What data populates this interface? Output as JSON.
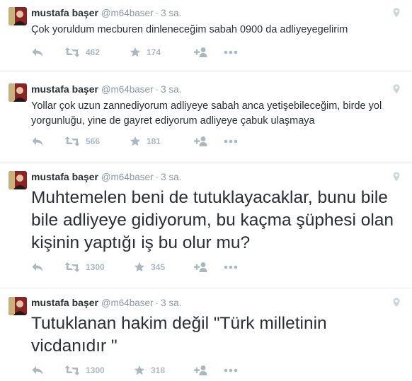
{
  "tweets": [
    {
      "name": "mustafa başer",
      "handle": "@m64baser",
      "time": "3 sa.",
      "text": "Çok yoruldum mecburen dinleneceğim sabah 0900 da adliyeyegelirim",
      "retweets": "462",
      "favorites": "174"
    },
    {
      "name": "mustafa başer",
      "handle": "@m64baser",
      "time": "3 sa.",
      "text": "Yollar çok uzun zannediyorum adliyeye sabah anca yetişebileceğim, birde yol yorgunluğu, yine de gayret ediyorum adliyeye çabuk ulaşmaya",
      "retweets": "566",
      "favorites": "181"
    },
    {
      "name": "mustafa başer",
      "handle": "@m64baser",
      "time": "3 sa.",
      "text": "Muhtemelen beni de tutuklayacaklar, bunu bile bile adliyeye gidiyorum, bu kaçma şüphesi olan kişinin yaptığı iş bu olur mu?",
      "retweets": "1300",
      "favorites": "345"
    },
    {
      "name": "mustafa başer",
      "handle": "@m64baser",
      "time": "3 sa.",
      "text": "Tutuklanan hakim değil \"Türk milletinin vicdanıdır \"",
      "retweets": "1300",
      "favorites": "318"
    }
  ],
  "colors": {
    "icon": "#aab8c2",
    "meta": "#8899a6",
    "text": "#292f33",
    "divider": "#e1e8ed"
  },
  "icons": [
    "reply-icon",
    "retweet-icon",
    "star-icon",
    "follow-icon",
    "more-icon",
    "location-icon"
  ]
}
